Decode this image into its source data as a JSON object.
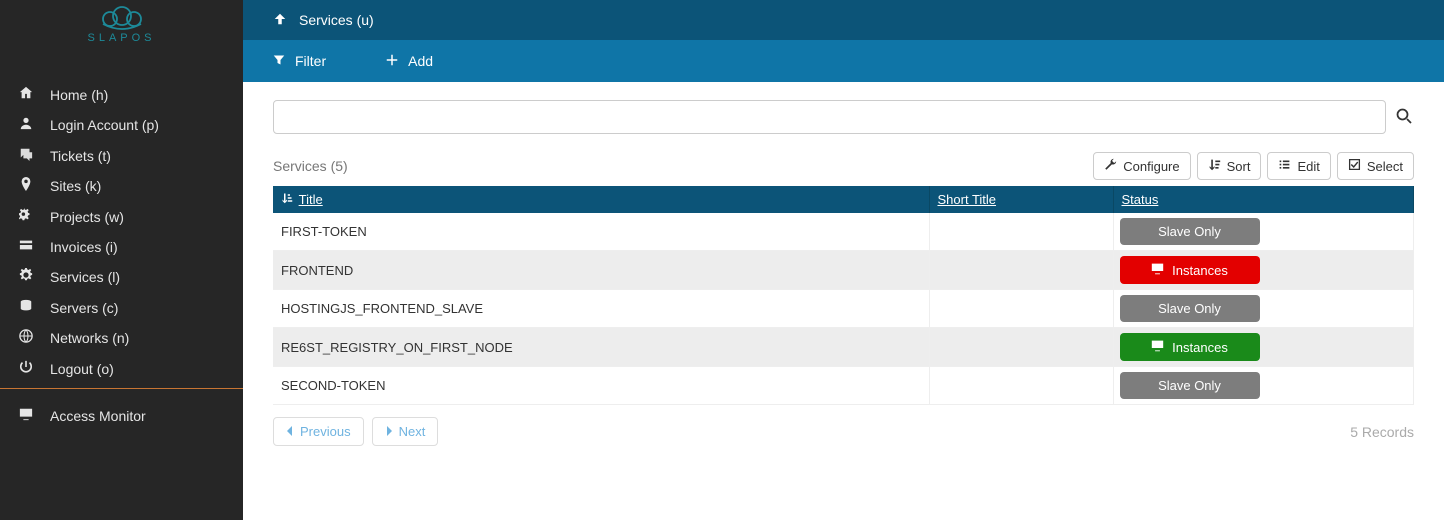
{
  "brand": {
    "name": "SLAPOS"
  },
  "sidebar": {
    "items": [
      {
        "label": "Home (h)",
        "icon": "home-icon"
      },
      {
        "label": "Login Account (p)",
        "icon": "user-icon"
      },
      {
        "label": "Tickets (t)",
        "icon": "comments-icon"
      },
      {
        "label": "Sites (k)",
        "icon": "map-pin-icon"
      },
      {
        "label": "Projects (w)",
        "icon": "gears-icon"
      },
      {
        "label": "Invoices (i)",
        "icon": "card-icon"
      },
      {
        "label": "Services (l)",
        "icon": "cog-icon"
      },
      {
        "label": "Servers (c)",
        "icon": "database-icon"
      },
      {
        "label": "Networks (n)",
        "icon": "globe-icon"
      },
      {
        "label": "Logout (o)",
        "icon": "power-icon"
      }
    ],
    "monitor": {
      "label": "Access Monitor",
      "icon": "desktop-icon"
    }
  },
  "topbar": {
    "title": "Services (u)"
  },
  "actionbar": {
    "filter": "Filter",
    "add": "Add"
  },
  "search": {
    "value": "",
    "placeholder": ""
  },
  "list": {
    "count_label": "Services (5)",
    "toolbar": {
      "configure": "Configure",
      "sort": "Sort",
      "edit": "Edit",
      "select": "Select"
    },
    "columns": {
      "title": "Title",
      "short_title": "Short Title",
      "status": "Status"
    },
    "rows": [
      {
        "title": "FIRST-TOKEN",
        "short_title": "",
        "status_label": "Slave Only",
        "status_kind": "slave"
      },
      {
        "title": "FRONTEND",
        "short_title": "",
        "status_label": "Instances",
        "status_kind": "red"
      },
      {
        "title": "HOSTINGJS_FRONTEND_SLAVE",
        "short_title": "",
        "status_label": "Slave Only",
        "status_kind": "slave"
      },
      {
        "title": "RE6ST_REGISTRY_ON_FIRST_NODE",
        "short_title": "",
        "status_label": "Instances",
        "status_kind": "green"
      },
      {
        "title": "SECOND-TOKEN",
        "short_title": "",
        "status_label": "Slave Only",
        "status_kind": "slave"
      }
    ],
    "pager": {
      "previous": "Previous",
      "next": "Next"
    },
    "records_label": "5 Records"
  }
}
